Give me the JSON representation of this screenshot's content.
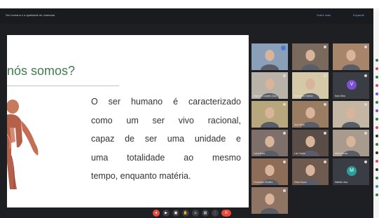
{
  "meeting": {
    "title": "Ser humano e a qualidade de chamada",
    "header_links": [
      "Sobre mais",
      "Expandir"
    ]
  },
  "slide": {
    "title": "nós somos?",
    "text_lines": [
      "O ser humano é caracterizado",
      "como um ser vivo racional,",
      "capaz de ser uma unidade e",
      "uma totalidade ao mesmo",
      "tempo, enquanto matéria."
    ]
  },
  "participants": [
    {
      "name": "",
      "kind": "photo",
      "bg": "#8aa0b8",
      "indicator": "active"
    },
    {
      "name": "",
      "kind": "photo",
      "bg": "#7a6a5e"
    },
    {
      "name": "",
      "kind": "photo",
      "bg": "#a6856a"
    },
    {
      "name": "Maria de Lourdes Cam...",
      "kind": "photo",
      "bg": "#b9b2a8"
    },
    {
      "name": "Rosemara Cristina",
      "kind": "photo",
      "bg": "#d6c9a8"
    },
    {
      "name": "Nara Silva",
      "kind": "avatar",
      "bg": "#3a3d44",
      "initial": "V",
      "avatar_color": "#7c4fd6"
    },
    {
      "name": "",
      "kind": "photo",
      "bg": "#b8a67c"
    },
    {
      "name": "Ana Paula",
      "kind": "photo",
      "bg": "#9a7c62"
    },
    {
      "name": "",
      "kind": "photo",
      "bg": "#c4b6a2"
    },
    {
      "name": "Lucia Alves",
      "kind": "photo",
      "bg": "#7e6f6a"
    },
    {
      "name": "Luiz Carlos",
      "kind": "photo",
      "bg": "#5a4d47"
    },
    {
      "name": "Marta Souza",
      "kind": "photo",
      "bg": "#a89a8c"
    },
    {
      "name": "Conceição Ferreira",
      "kind": "photo",
      "bg": "#8d6d57"
    },
    {
      "name": "Edna Souza",
      "kind": "photo",
      "bg": "#6e5a4e"
    },
    {
      "name": "Matilde Lima",
      "kind": "avatar",
      "bg": "#3a3d44",
      "initial": "M",
      "avatar_color": "#2a9f9a"
    },
    {
      "name": "",
      "kind": "photo",
      "bg": "#8f7463"
    }
  ],
  "controls": [
    {
      "icon": "mic-off-icon",
      "glyph": "●",
      "style": "red"
    },
    {
      "icon": "video-icon",
      "glyph": "▶",
      "style": ""
    },
    {
      "icon": "share-screen-icon",
      "glyph": "▣",
      "style": ""
    },
    {
      "icon": "raise-hand-icon",
      "glyph": "✋",
      "style": ""
    },
    {
      "icon": "reactions-icon",
      "glyph": "☺",
      "style": ""
    },
    {
      "icon": "chat-icon",
      "glyph": "▤",
      "style": ""
    },
    {
      "icon": "more-icon",
      "glyph": "⋮",
      "style": ""
    },
    {
      "icon": "end-call-icon",
      "glyph": "✆",
      "style": "end"
    }
  ],
  "colors": {
    "slide_title": "#3e7d4d",
    "accent_link": "#7fa7e8",
    "end_call": "#e84a3c"
  }
}
